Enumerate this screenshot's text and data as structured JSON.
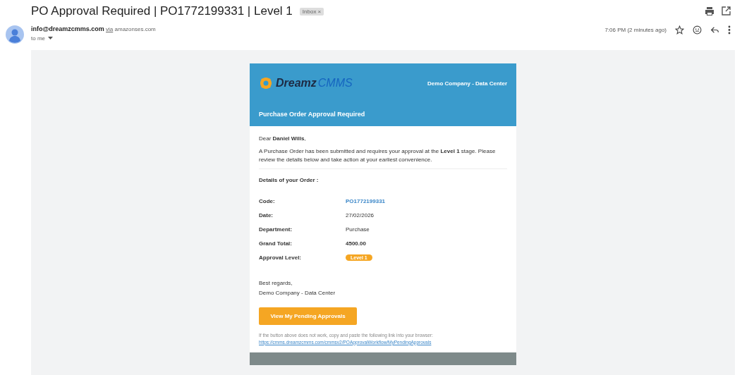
{
  "subject": "PO Approval Required | PO1772199331 | Level 1",
  "label": {
    "text": "Inbox",
    "close": "×"
  },
  "sender": {
    "email": "info@dreamzcmms.com",
    "via": "via",
    "domain": "amazonses.com",
    "to": "to me",
    "time": "7:06 PM (2 minutes ago)"
  },
  "email": {
    "logo": {
      "word1": "Dreamz",
      "word2": "CMMS"
    },
    "company": "Demo Company - Data Center",
    "heading": "Purchase Order Approval Required",
    "greeting": "Dear **Daniel Wills**,",
    "intro": "A Purchase Order has been submitted and requires your approval at the **Level 1** stage. Please review the details below and take action at your earliest convenience.",
    "details_title": "Details of your Order :",
    "details": [
      {
        "label": "Code:",
        "value": "PO1772199331",
        "kind": "link"
      },
      {
        "label": "Date:",
        "value": "27/02/2026",
        "kind": "plain"
      },
      {
        "label": "Department:",
        "value": "Purchase",
        "kind": "plain"
      },
      {
        "label": "Grand Total:",
        "value": "4500.00",
        "kind": "bold"
      },
      {
        "label": "Approval Level:",
        "value": "Level 1",
        "kind": "badge"
      }
    ],
    "closing": "Best regards,",
    "signature": "Demo Company - Data Center",
    "button": "View My Pending Approvals",
    "fallback": "If the button above does not work, copy and paste the following link into your browser:",
    "link": "https://cmms.dreamzcmms.com/cmmsv2/POApprovalWorkflow/MyPendingApprovals"
  }
}
